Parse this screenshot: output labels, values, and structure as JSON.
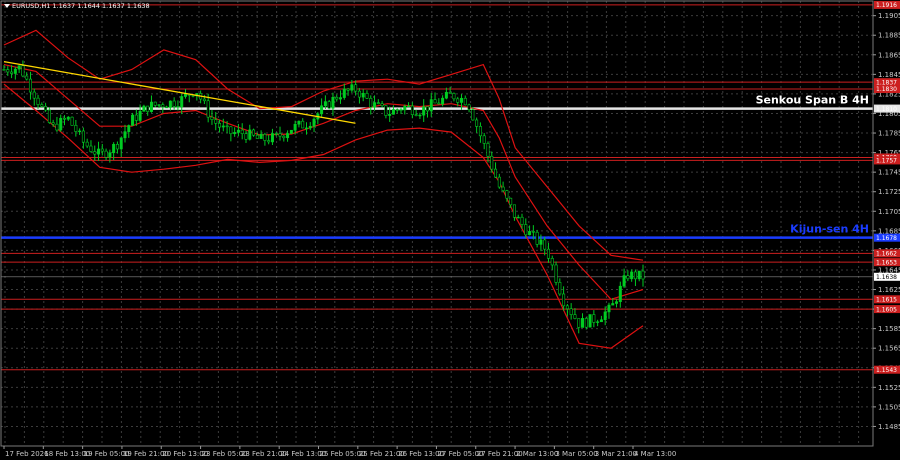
{
  "header": {
    "symbol_info": "EURUSD,H1  1.1637 1.1644 1.1637 1.1638"
  },
  "chart_data": {
    "type": "candlestick",
    "title": "EURUSD,H1  1.1637 1.1644 1.1637 1.1638",
    "ylim": [
      1.1465,
      1.192
    ],
    "y_ticks": [
      "1.1905",
      "1.1885",
      "1.1865",
      "1.1845",
      "1.1825",
      "1.1805",
      "1.1785",
      "1.1765",
      "1.1745",
      "1.1725",
      "1.1705",
      "1.1685",
      "1.1665",
      "1.1645",
      "1.1625",
      "1.1605",
      "1.1585",
      "1.1565",
      "1.1545",
      "1.1525",
      "1.1505",
      "1.1485"
    ],
    "x_ticks": [
      "17 Feb 2026",
      "18 Feb 13:00",
      "19 Feb 05:00",
      "19 Feb 21:00",
      "20 Feb 13:00",
      "23 Feb 05:00",
      "23 Feb 21:00",
      "24 Feb 13:00",
      "25 Feb 05:00",
      "25 Feb 21:00",
      "26 Feb 13:00",
      "27 Feb 05:00",
      "27 Feb 21:00",
      "2 Mar 13:00",
      "3 Mar 05:00",
      "3 Mar 21:00",
      "4 Mar 13:00"
    ],
    "x_range": [
      0,
      160
    ],
    "levels": [
      {
        "price": 1.1916,
        "color": "#cc1f1f",
        "label": "1.1916"
      },
      {
        "price": 1.1837,
        "color": "#cc1f1f",
        "label": "1.1837"
      },
      {
        "price": 1.183,
        "color": "#cc1f1f",
        "label": "1.1830"
      },
      {
        "price": 1.181,
        "color": "#e6e6e6",
        "label": "1.1810",
        "name": "Senkou Span B 4H",
        "bold": true
      },
      {
        "price": 1.176,
        "color": "#cc1f1f",
        "label": "1.1760"
      },
      {
        "price": 1.1757,
        "color": "#cc1f1f",
        "label": "1.1757"
      },
      {
        "price": 1.1678,
        "color": "#1a3cff",
        "label": "1.1678",
        "name": "Kijun-sen 4H",
        "bold": true
      },
      {
        "price": 1.1662,
        "color": "#cc1f1f",
        "label": "1.1662"
      },
      {
        "price": 1.1653,
        "color": "#cc1f1f",
        "label": "1.1653"
      },
      {
        "price": 1.1615,
        "color": "#cc1f1f",
        "label": "1.1615"
      },
      {
        "price": 1.1605,
        "color": "#cc1f1f",
        "label": "1.1605"
      },
      {
        "price": 1.1543,
        "color": "#cc1f1f",
        "label": "1.1543"
      }
    ],
    "current_price": {
      "price": 1.1638,
      "label": "1.1638"
    },
    "trendline": {
      "x": [
        0,
        88
      ],
      "y": [
        1.1858,
        1.1795
      ],
      "color": "#ffd700"
    },
    "close_path": {
      "x": [
        0,
        4,
        8,
        12,
        16,
        20,
        24,
        28,
        32,
        36,
        40,
        44,
        48,
        52,
        56,
        60,
        64,
        68,
        72,
        76,
        80,
        84,
        88,
        92,
        96,
        100,
        104,
        108,
        112,
        116,
        120,
        124,
        128,
        132,
        136,
        140,
        144,
        148,
        152,
        156,
        160
      ],
      "y": [
        1.185,
        1.1852,
        1.1822,
        1.179,
        1.18,
        1.1775,
        1.1762,
        1.1772,
        1.1798,
        1.1812,
        1.1815,
        1.1818,
        1.183,
        1.1799,
        1.1785,
        1.1785,
        1.1778,
        1.178,
        1.179,
        1.1795,
        1.181,
        1.1825,
        1.183,
        1.1815,
        1.1805,
        1.1812,
        1.1808,
        1.1815,
        1.1824,
        1.1818,
        1.1775,
        1.173,
        1.17,
        1.168,
        1.1665,
        1.1615,
        1.159,
        1.1595,
        1.1605,
        1.164,
        1.1638
      ]
    },
    "bollinger": {
      "color": "#dd1111",
      "upper": {
        "x": [
          0,
          8,
          16,
          24,
          32,
          40,
          48,
          56,
          64,
          72,
          80,
          88,
          96,
          104,
          112,
          120,
          124,
          128,
          136,
          144,
          152,
          160
        ],
        "y": [
          1.1875,
          1.189,
          1.1862,
          1.184,
          1.185,
          1.187,
          1.186,
          1.183,
          1.181,
          1.1812,
          1.1828,
          1.1838,
          1.184,
          1.1835,
          1.1845,
          1.1855,
          1.182,
          1.177,
          1.173,
          1.169,
          1.166,
          1.1655
        ]
      },
      "mid": {
        "x": [
          0,
          8,
          16,
          24,
          32,
          40,
          48,
          56,
          64,
          72,
          80,
          88,
          96,
          104,
          112,
          120,
          124,
          128,
          136,
          144,
          152,
          160
        ],
        "y": [
          1.1855,
          1.1848,
          1.182,
          1.1792,
          1.1792,
          1.1805,
          1.1808,
          1.1795,
          1.1783,
          1.1784,
          1.1795,
          1.1808,
          1.1815,
          1.1812,
          1.1815,
          1.1808,
          1.178,
          1.174,
          1.169,
          1.165,
          1.1615,
          1.1625
        ]
      },
      "lower": {
        "x": [
          0,
          8,
          16,
          24,
          32,
          40,
          48,
          56,
          64,
          72,
          80,
          88,
          96,
          104,
          112,
          120,
          124,
          128,
          136,
          144,
          152,
          160
        ],
        "y": [
          1.1835,
          1.1808,
          1.178,
          1.175,
          1.1745,
          1.1748,
          1.1752,
          1.1758,
          1.1755,
          1.1757,
          1.1763,
          1.1778,
          1.1788,
          1.179,
          1.1786,
          1.176,
          1.1735,
          1.17,
          1.164,
          1.157,
          1.1565,
          1.1588
        ]
      }
    }
  }
}
